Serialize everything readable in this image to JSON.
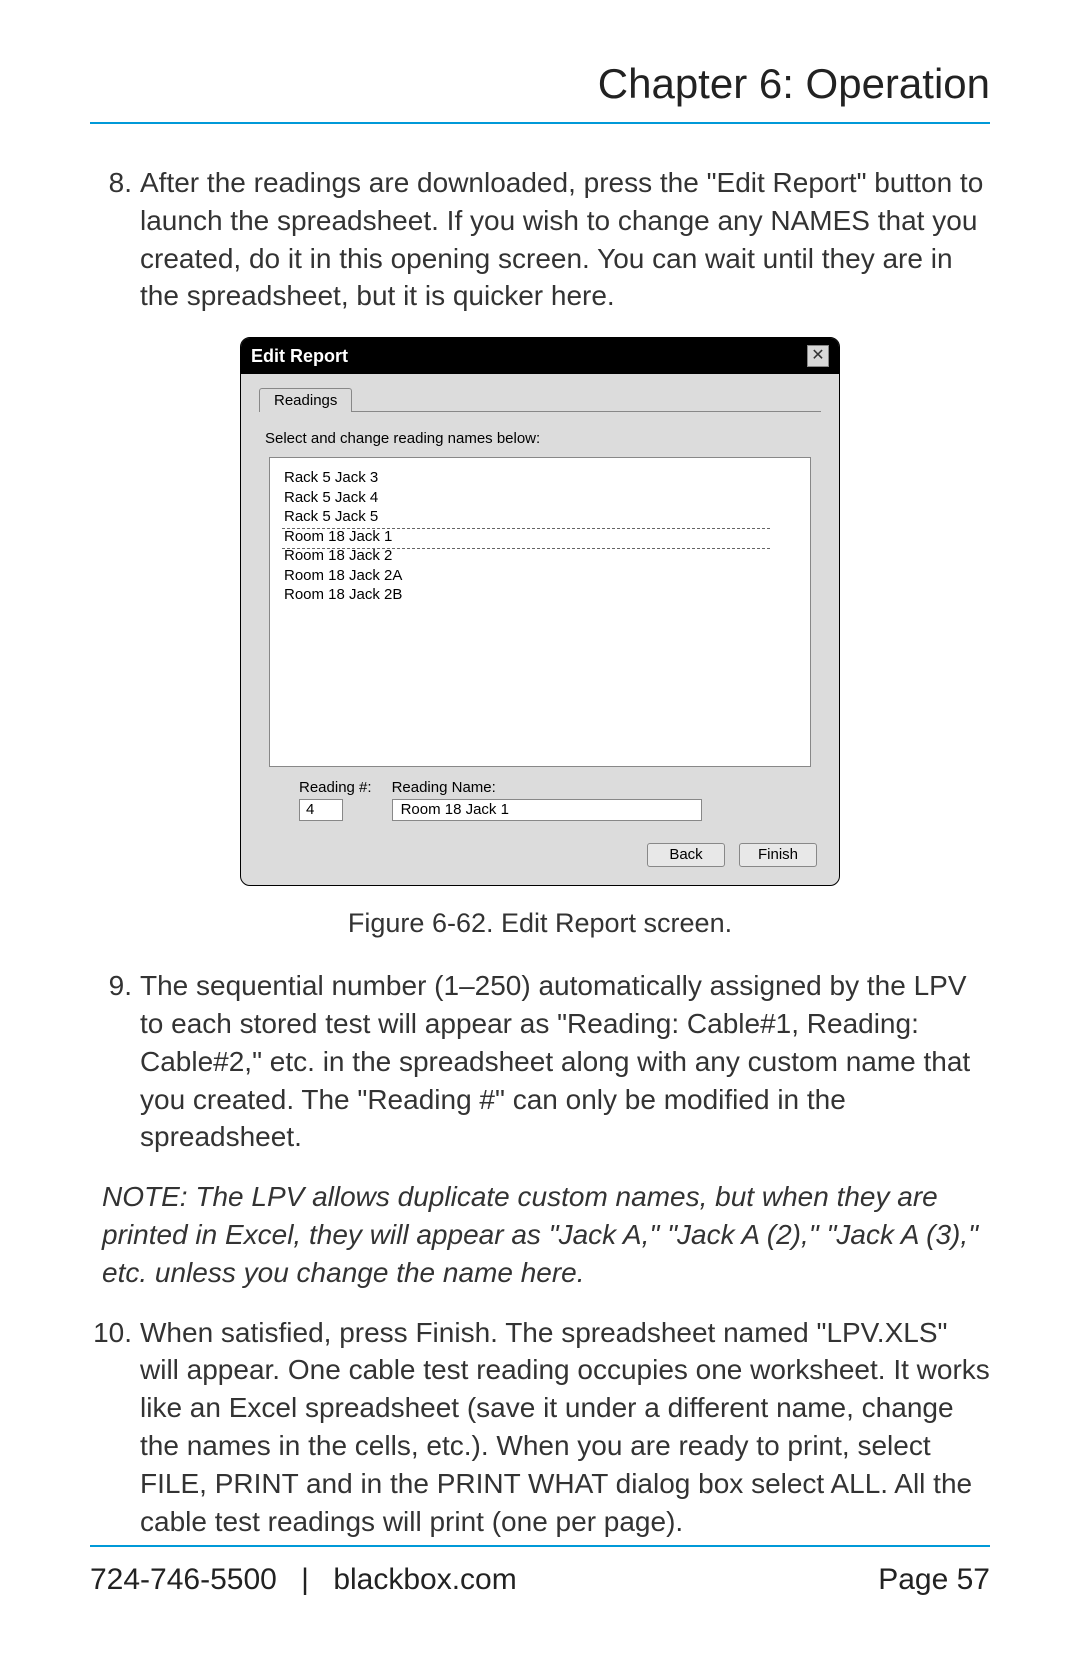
{
  "header": {
    "chapter_title": "Chapter 6: Operation"
  },
  "steps": {
    "s8": {
      "num": "8.",
      "text": "After the readings are downloaded, press the \"Edit Report\" button to launch the spreadsheet. If you wish to change any NAMES that you created, do it in this opening screen. You can wait until they are in the spreadsheet, but it is quicker here."
    },
    "s9": {
      "num": "9.",
      "text": "The sequential number (1–250) automatically assigned by the LPV to each stored test will appear as \"Reading: Cable#1, Reading: Cable#2,\" etc. in the spreadsheet along with any custom name that you created. The \"Reading #\" can only be modified in the spreadsheet."
    },
    "s10": {
      "num": "10.",
      "text": "When satisfied, press Finish. The spreadsheet named \"LPV.XLS\" will appear. One cable test reading occupies one work­sheet. It works like an Excel spreadsheet (save it under a dif­ferent name, change the names in the cells, etc.). When you are ready to print, select FILE, PRINT and in the PRINT WHAT dialog box select ALL. All the cable test readings will print (one per page)."
    }
  },
  "note": {
    "label": "NOTE:",
    "text": " The LPV allows duplicate custom names, but when they are printed in Excel, they will appear as \"Jack A,\" \"Jack A (2),\" \"Jack A (3),\" etc. unless you change the name here."
  },
  "figure": {
    "caption": "Figure 6-62. Edit Report screen."
  },
  "dialog": {
    "title": "Edit Report",
    "close": "✕",
    "tab": "Readings",
    "instruction": "Select and change reading names below:",
    "list": {
      "i0": "Rack 5 Jack 3",
      "i1": "Rack 5 Jack 4",
      "i2": "Rack 5 Jack 5",
      "i3": "Room 18 Jack 1",
      "i4": "Room 18 Jack 2",
      "i5": "Room 18 Jack 2A",
      "i6": "Room 18 Jack 2B"
    },
    "reading_num_label": "Reading #:",
    "reading_num_value": "4",
    "reading_name_label": "Reading Name:",
    "reading_name_value": "Room 18 Jack 1",
    "back": "Back",
    "finish": "Finish"
  },
  "footer": {
    "phone": "724-746-5500",
    "site": "blackbox.com",
    "page": "Page 57"
  }
}
